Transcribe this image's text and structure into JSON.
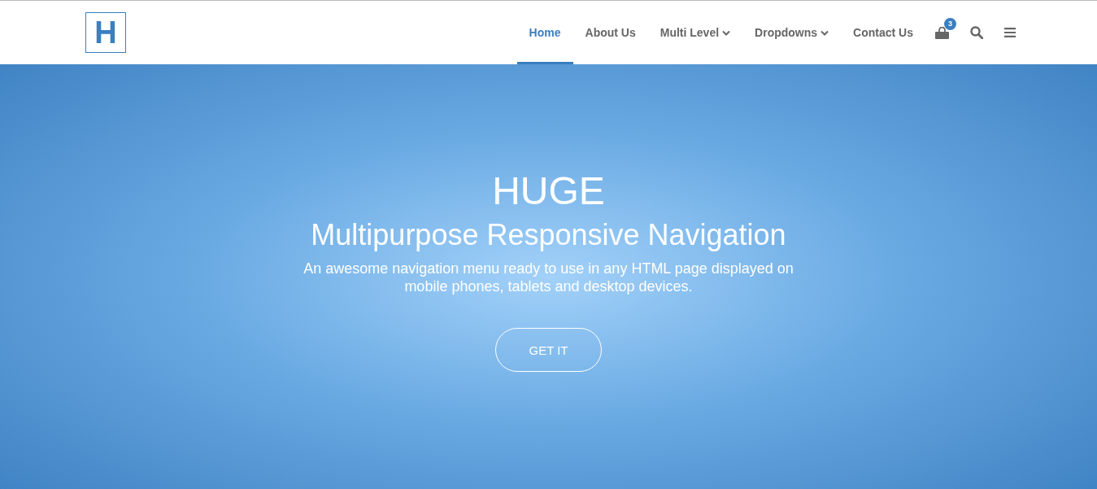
{
  "logo": {
    "letter": "H"
  },
  "nav": [
    {
      "label": "Home",
      "selected": true,
      "dropdown": false
    },
    {
      "label": "About Us",
      "selected": false,
      "dropdown": false
    },
    {
      "label": "Multi Level",
      "selected": false,
      "dropdown": true
    },
    {
      "label": "Dropdowns",
      "selected": false,
      "dropdown": true
    },
    {
      "label": "Contact Us",
      "selected": false,
      "dropdown": false
    }
  ],
  "cart": {
    "count": "3"
  },
  "hero": {
    "title": "HUGE",
    "subtitle": "Multipurpose Responsive Navigation",
    "description": "An awesome navigation menu ready to use in any HTML page displayed on mobile phones, tablets and desktop devices.",
    "button": "GET IT"
  }
}
